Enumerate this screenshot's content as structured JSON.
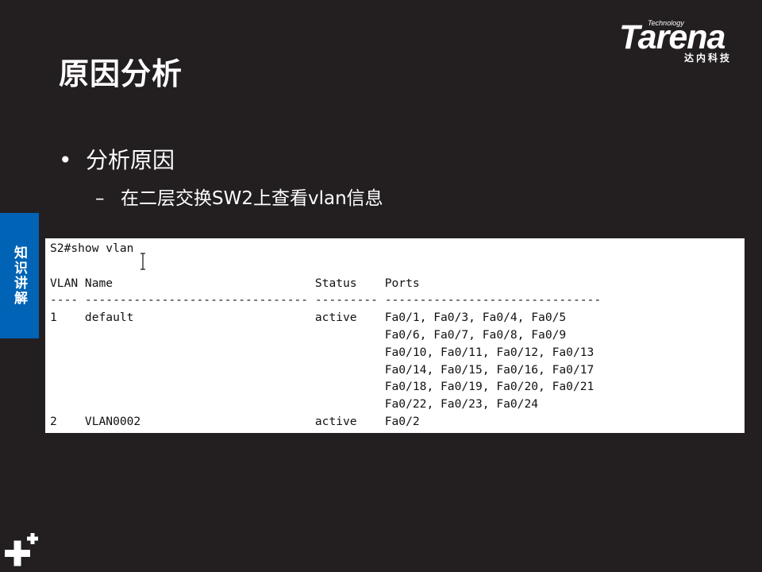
{
  "slide": {
    "title": "原因分析",
    "bullet": "分析原因",
    "bullet_marker": "•",
    "sub_bullet": "在二层交换SW2上查看vlan信息",
    "sub_marker": "–",
    "side_tab": "知识讲解"
  },
  "logo": {
    "tech": "Technology",
    "word": "Tarena",
    "chinese": "达内科技"
  },
  "terminal": {
    "lines": [
      "S2#show vlan",
      "",
      "VLAN Name                             Status    Ports",
      "---- -------------------------------- --------- -------------------------------",
      "1    default                          active    Fa0/1, Fa0/3, Fa0/4, Fa0/5",
      "                                                Fa0/6, Fa0/7, Fa0/8, Fa0/9",
      "                                                Fa0/10, Fa0/11, Fa0/12, Fa0/13",
      "                                                Fa0/14, Fa0/15, Fa0/16, Fa0/17",
      "                                                Fa0/18, Fa0/19, Fa0/20, Fa0/21",
      "                                                Fa0/22, Fa0/23, Fa0/24",
      "2    VLAN0002                         active    Fa0/2"
    ]
  },
  "icons": {
    "corner": "plus-decoration-icon",
    "cursor": "text-cursor-icon"
  },
  "colors": {
    "background": "#231f20",
    "side_tab": "#0063b5",
    "terminal_bg": "#ffffff"
  }
}
